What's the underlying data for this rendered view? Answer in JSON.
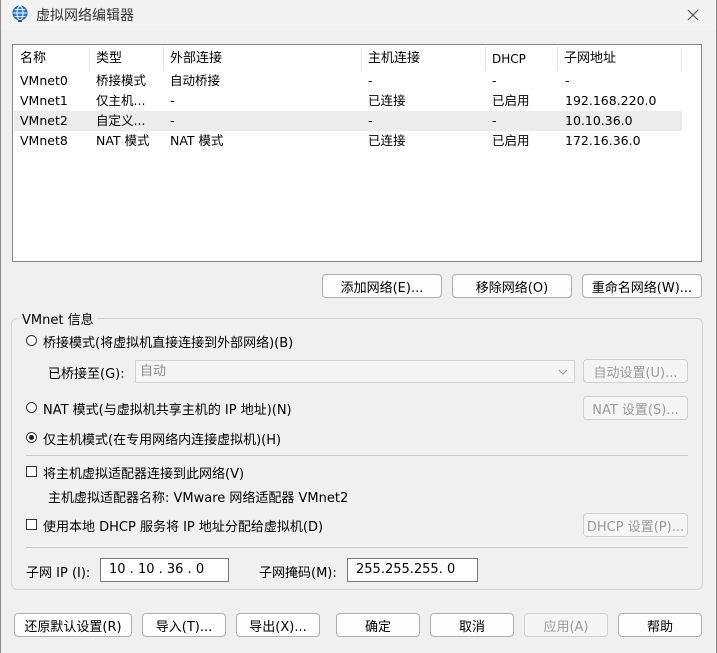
{
  "window": {
    "title": "虚拟网络编辑器"
  },
  "list": {
    "columns": [
      "名称",
      "类型",
      "外部连接",
      "主机连接",
      "DHCP",
      "子网地址"
    ],
    "rows": [
      {
        "name": "VMnet0",
        "type": "桥接模式",
        "external": "自动桥接",
        "host": "-",
        "dhcp": "-",
        "subnet": "-"
      },
      {
        "name": "VMnet1",
        "type": "仅主机...",
        "external": "-",
        "host": "已连接",
        "dhcp": "已启用",
        "subnet": "192.168.220.0"
      },
      {
        "name": "VMnet2",
        "type": "自定义...",
        "external": "-",
        "host": "-",
        "dhcp": "-",
        "subnet": "10.10.36.0"
      },
      {
        "name": "VMnet8",
        "type": "NAT 模式",
        "external": "NAT 模式",
        "host": "已连接",
        "dhcp": "已启用",
        "subnet": "172.16.36.0"
      }
    ],
    "selected_row": "VMnet2"
  },
  "list_buttons": {
    "add": "添加网络(E)...",
    "remove": "移除网络(O)",
    "rename": "重命名网络(W)..."
  },
  "vmnet_info": {
    "title": "VMnet 信息",
    "bridged_label": "桥接模式(将虚拟机直接连接到外部网络)(B)",
    "bridged_to_label": "已桥接至(G):",
    "bridged_to_value": "自动",
    "auto_settings": "自动设置(U)...",
    "nat_label": "NAT 模式(与虚拟机共享主机的 IP 地址)(N)",
    "nat_settings": "NAT 设置(S)...",
    "hostonly_label": "仅主机模式(在专用网络内连接虚拟机)(H)",
    "selected_mode": "hostonly",
    "connect_adapter_label": "将主机虚拟适配器连接到此网络(V)",
    "connect_adapter_checked": false,
    "adapter_name_label": "主机虚拟适配器名称: VMware 网络适配器 VMnet2",
    "dhcp_label": "使用本地 DHCP 服务将 IP 地址分配给虚拟机(D)",
    "dhcp_checked": false,
    "dhcp_settings": "DHCP 设置(P)...",
    "subnet_ip_label": "子网 IP (I):",
    "subnet_ip_value": "10 . 10 . 36 . 0",
    "subnet_mask_label": "子网掩码(M):",
    "subnet_mask_value": "255.255.255. 0"
  },
  "footer": {
    "restore": "还原默认设置(R)",
    "import": "导入(T)...",
    "export": "导出(X)...",
    "ok": "确定",
    "cancel": "取消",
    "apply": "应用(A)",
    "help": "帮助"
  },
  "colors": {
    "title_icon": "#1e6fb8",
    "selected_row": "#ececec"
  }
}
